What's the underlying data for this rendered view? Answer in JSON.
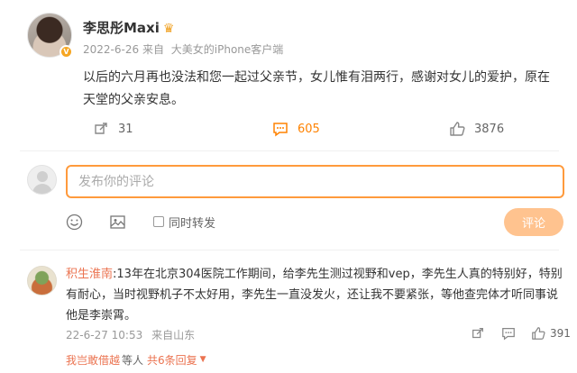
{
  "post": {
    "author": "李思彤Maxi",
    "date": "2022-6-26",
    "source_prefix": "来自",
    "source": "大美女的iPhone客户端",
    "text": "以后的六月再也没法和您一起过父亲节，女儿惟有泪两行，感谢对女儿的爱护，原在天堂的父亲安息。",
    "reposts": "31",
    "comments": "605",
    "likes": "3876"
  },
  "composer": {
    "placeholder": "发布你的评论",
    "forward_label": "同时转发",
    "submit_label": "评论"
  },
  "comment": {
    "author": "积生淮南",
    "text": ":13年在北京304医院工作期间，给李先生测过视野和vep，李先生人真的特别好，特别有耐心，当时视野机子不太好用，李先生一直没发火，还让我不要紧张，等他查完体才听同事说他是李崇霄。",
    "date": "22-6-27 10:53",
    "location": "来自山东",
    "likes": "391"
  },
  "replies": {
    "names": "我岂敢借越",
    "others": "等人",
    "count": "共6条回复",
    "caret": "▼"
  },
  "colors": {
    "accent": "#ff8200",
    "link": "#eb7350",
    "submit": "#ffc38f",
    "input_border": "#ff9a3c"
  },
  "icons": [
    "crown-icon",
    "repost-icon",
    "comment-icon",
    "like-icon",
    "emoji-icon",
    "image-icon",
    "checkbox-icon"
  ]
}
